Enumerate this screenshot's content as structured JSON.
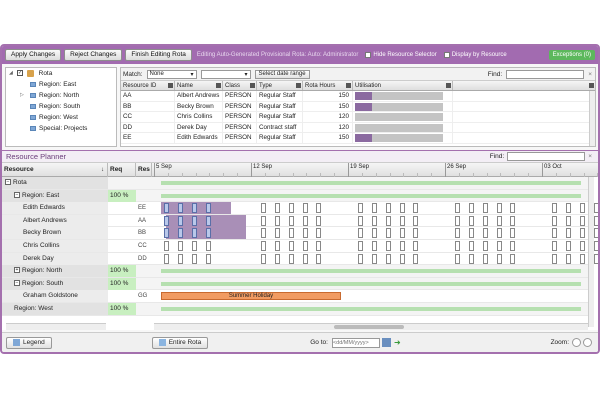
{
  "toolbar": {
    "apply_label": "Apply Changes",
    "reject_label": "Reject Changes",
    "finish_label": "Finish Editing Rota",
    "editing_text": "Editing Auto-Generated Provisional Rota: Auto: Administrator",
    "hide_selector_label": "Hide Resource Selector",
    "display_by_label": "Display by Resource",
    "exceptions_label": "Exceptions (0)"
  },
  "tree": {
    "root": "Rota",
    "items": [
      "Region: East",
      "Region: North",
      "Region: South",
      "Region: West",
      "Special: Projects"
    ]
  },
  "resource_grid": {
    "match_label": "Match:",
    "match_value": "None",
    "date_range_label": "Select date range",
    "find_label": "Find:",
    "columns": [
      "Resource ID",
      "Name",
      "Class",
      "Type",
      "Rota Hours",
      "Utilisation"
    ],
    "rows": [
      {
        "id": "AA",
        "name": "Albert Andrews",
        "class": "PERSON",
        "type": "Regular Staff",
        "hours": "150",
        "util": 0.19
      },
      {
        "id": "BB",
        "name": "Becky Brown",
        "class": "PERSON",
        "type": "Regular Staff",
        "hours": "150",
        "util": 0.19
      },
      {
        "id": "CC",
        "name": "Chris Collins",
        "class": "PERSON",
        "type": "Regular Staff",
        "hours": "120",
        "util": 0.0
      },
      {
        "id": "DD",
        "name": "Derek Day",
        "class": "PERSON",
        "type": "Contract staff",
        "hours": "120",
        "util": 0.0
      },
      {
        "id": "EE",
        "name": "Edith Edwards",
        "class": "PERSON",
        "type": "Regular Staff",
        "hours": "150",
        "util": 0.19
      }
    ]
  },
  "planner": {
    "title": "Resource Planner",
    "find_label": "Find:",
    "col_resource": "Resource",
    "col_req": "Req",
    "col_res": "Res",
    "dates": [
      "5 Sep",
      "12 Sep",
      "19 Sep",
      "26 Sep",
      "03 Oct"
    ],
    "rows": [
      {
        "name": "Rota",
        "req": "",
        "code": "",
        "level": 0,
        "expander": "-",
        "kind": "group"
      },
      {
        "name": "Region: East",
        "req": "100 %",
        "code": "",
        "level": 1,
        "expander": "-",
        "kind": "group"
      },
      {
        "name": "Edith Edwards",
        "req": "",
        "code": "EE",
        "level": 2,
        "expander": "",
        "kind": "person"
      },
      {
        "name": "Albert Andrews",
        "req": "",
        "code": "AA",
        "level": 2,
        "expander": "",
        "kind": "person"
      },
      {
        "name": "Becky Brown",
        "req": "",
        "code": "BB",
        "level": 2,
        "expander": "",
        "kind": "person"
      },
      {
        "name": "Chris Collins",
        "req": "",
        "code": "CC",
        "level": 2,
        "expander": "",
        "kind": "person"
      },
      {
        "name": "Derek Day",
        "req": "",
        "code": "DD",
        "level": 2,
        "expander": "",
        "kind": "person"
      },
      {
        "name": "Region: North",
        "req": "100 %",
        "code": "",
        "level": 1,
        "expander": "+",
        "kind": "group"
      },
      {
        "name": "Region: South",
        "req": "100 %",
        "code": "",
        "level": 1,
        "expander": "-",
        "kind": "group"
      },
      {
        "name": "Graham Goldstone",
        "req": "",
        "code": "GG",
        "level": 2,
        "expander": "",
        "kind": "holiday"
      },
      {
        "name": "Region: West",
        "req": "100 %",
        "code": "",
        "level": 1,
        "expander": "",
        "kind": "group"
      }
    ],
    "holiday_label": "Summer Holiday"
  },
  "status": {
    "legend_label": "Legend",
    "entire_rota_label": "Entire Rota",
    "goto_label": "Go to:",
    "date_placeholder": "<dd/MM/yyyy>",
    "zoom_label": "Zoom:"
  },
  "colors": {
    "accent": "#a26bb0",
    "exceptions": "#5cb85c",
    "req_green": "#c8efc0",
    "holiday": "#f19b62",
    "shift_shade": "#a98fb7"
  }
}
